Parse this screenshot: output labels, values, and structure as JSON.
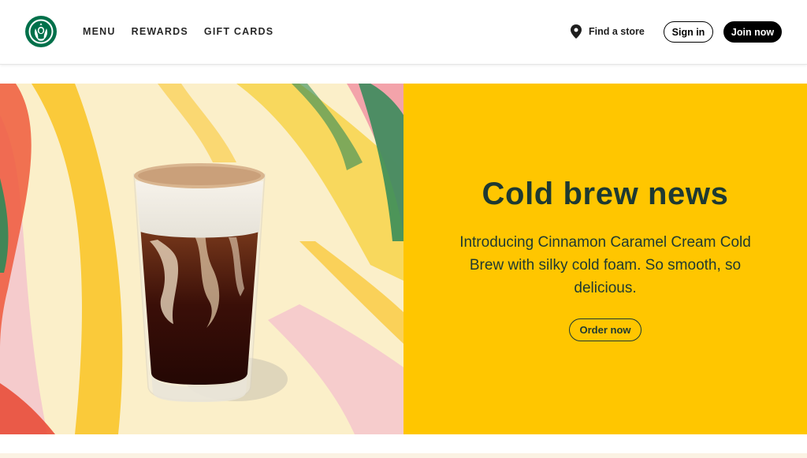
{
  "header": {
    "logo_icon": "starbucks-siren-logo",
    "nav": [
      {
        "label": "MENU"
      },
      {
        "label": "REWARDS"
      },
      {
        "label": "GIFT CARDS"
      }
    ],
    "find_store_icon": "location-pin-icon",
    "find_store_label": "Find a store",
    "sign_in_label": "Sign in",
    "join_label": "Join now"
  },
  "hero": {
    "title": "Cold brew news",
    "body": "Introducing Cinnamon Caramel Cream Cold Brew with silky cold foam. So smooth, so delicious.",
    "cta_label": "Order now",
    "image_subject": "cold-brew-glass-with-cold-foam",
    "panel_color": "#ffc600",
    "text_color": "#1e3932"
  }
}
